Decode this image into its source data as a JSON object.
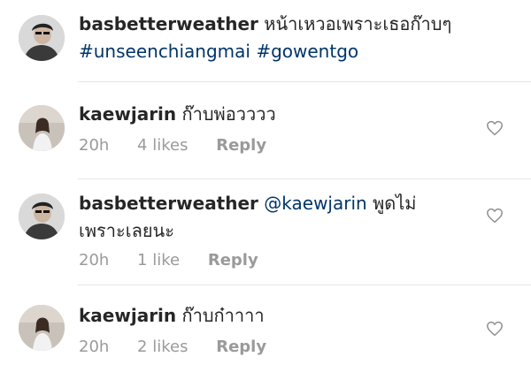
{
  "caption": {
    "username": "basbetterweather",
    "text": "หน้าเหวอเพราะเธอก๊าบๆ",
    "hashtags": [
      "#unseenchiangmai",
      "#gowentgo"
    ]
  },
  "comments": [
    {
      "username": "kaewjarin",
      "text": "ก๊าบพ่อวววว",
      "time": "20h",
      "likes": "4 likes",
      "reply_label": "Reply"
    },
    {
      "username": "basbetterweather",
      "mention": "@kaewjarin",
      "text_line1": "พูดไม่",
      "text_line2": "เพราะเลยนะ",
      "time": "20h",
      "likes": "1 like",
      "reply_label": "Reply"
    },
    {
      "username": "kaewjarin",
      "text": "ก๊าบก๋าาาา",
      "time": "20h",
      "likes": "2 likes",
      "reply_label": "Reply"
    }
  ],
  "icons": {
    "heart": "heart-outline-icon"
  },
  "colors": {
    "text": "#262626",
    "hashtag": "#003569",
    "meta": "#9a9a9a",
    "divider": "#e6e6e6"
  }
}
